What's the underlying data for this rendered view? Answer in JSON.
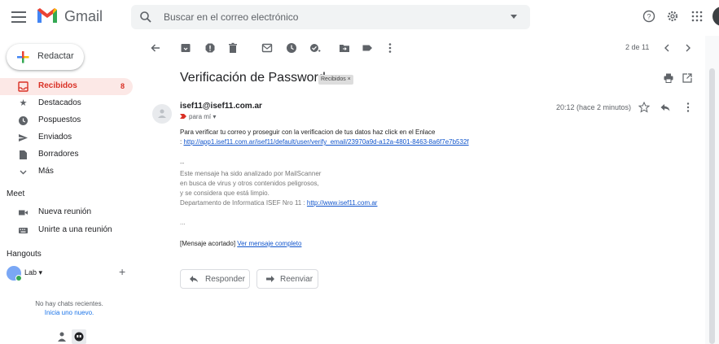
{
  "app": {
    "name": "Gmail"
  },
  "search": {
    "placeholder": "Buscar en el correo electrónico"
  },
  "compose": {
    "label": "Redactar"
  },
  "sidebar": {
    "items": [
      {
        "label": "Recibidos",
        "count": "8",
        "icon": "inbox-icon"
      },
      {
        "label": "Destacados",
        "icon": "star-icon"
      },
      {
        "label": "Pospuestos",
        "icon": "clock-icon"
      },
      {
        "label": "Enviados",
        "icon": "send-icon"
      },
      {
        "label": "Borradores",
        "icon": "draft-icon"
      },
      {
        "label": "Más",
        "icon": "chevron-down-icon"
      }
    ]
  },
  "meet": {
    "title": "Meet",
    "items": [
      {
        "label": "Nueva reunión",
        "icon": "video-icon"
      },
      {
        "label": "Unirte a una reunión",
        "icon": "keyboard-icon"
      }
    ]
  },
  "hangouts": {
    "title": "Hangouts",
    "user": "Lab",
    "no_chats": "No hay chats recientes.",
    "start_new": "Inicia uno nuevo."
  },
  "toolbar": {
    "pager": "2 de 11"
  },
  "message": {
    "subject": "Verificación de Password",
    "label": "Recibidos ×",
    "sender": "isef11@isef11.com.ar",
    "to": "para mí",
    "time": "20:12 (hace 2 minutos)",
    "body_line1": "Para verificar tu correo y proseguir con la verificacion de tus datos haz click en el Enlace",
    "body_line2_prefix": ": ",
    "body_link": "http://app1.isef11.com.ar/isef11/default/user/verify_email/23970a9d-a12a-4801-8463-8a6f7e7b532f",
    "sig_dashes": "--",
    "sig1": "Este mensaje ha sido analizado por MailScanner",
    "sig2": "en busca de virus y otros contenidos peligrosos,",
    "sig3": "y se considera que está limpio.",
    "sig4_prefix": "Departamento de Informatica ISEF Nro 11 : ",
    "sig4_link": "http://www.isef11.com.ar",
    "ellipsis": "...",
    "trimmed_prefix": "[Mensaje acortado]  ",
    "trimmed_link": "Ver mensaje completo"
  },
  "actions": {
    "reply": "Responder",
    "forward": "Reenviar"
  },
  "colors": {
    "accent": "#d93025",
    "link": "#1155cc",
    "active_bg": "#fce8e6"
  }
}
